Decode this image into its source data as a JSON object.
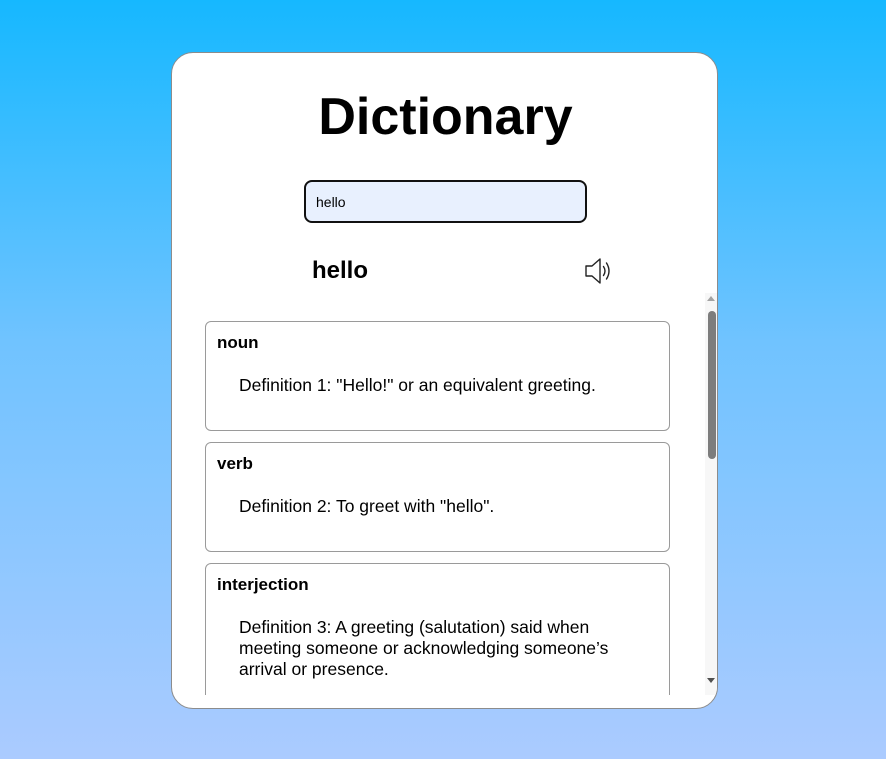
{
  "app": {
    "title": "Dictionary"
  },
  "search": {
    "value": "hello",
    "placeholder": ""
  },
  "result": {
    "word": "hello",
    "audio_icon": "speaker-icon",
    "meanings": [
      {
        "part_of_speech": "noun",
        "definition": "Definition 1: \"Hello!\" or an equivalent greeting."
      },
      {
        "part_of_speech": "verb",
        "definition": "Definition 2: To greet with \"hello\"."
      },
      {
        "part_of_speech": "interjection",
        "definition": "Definition 3: A greeting (salutation) said when meeting someone or acknowledging someone’s arrival or presence."
      }
    ]
  },
  "colors": {
    "background_top": "#16b8ff",
    "background_bottom": "#abcbff",
    "card": "#ffffff",
    "input_fill": "#e8f0fe"
  }
}
